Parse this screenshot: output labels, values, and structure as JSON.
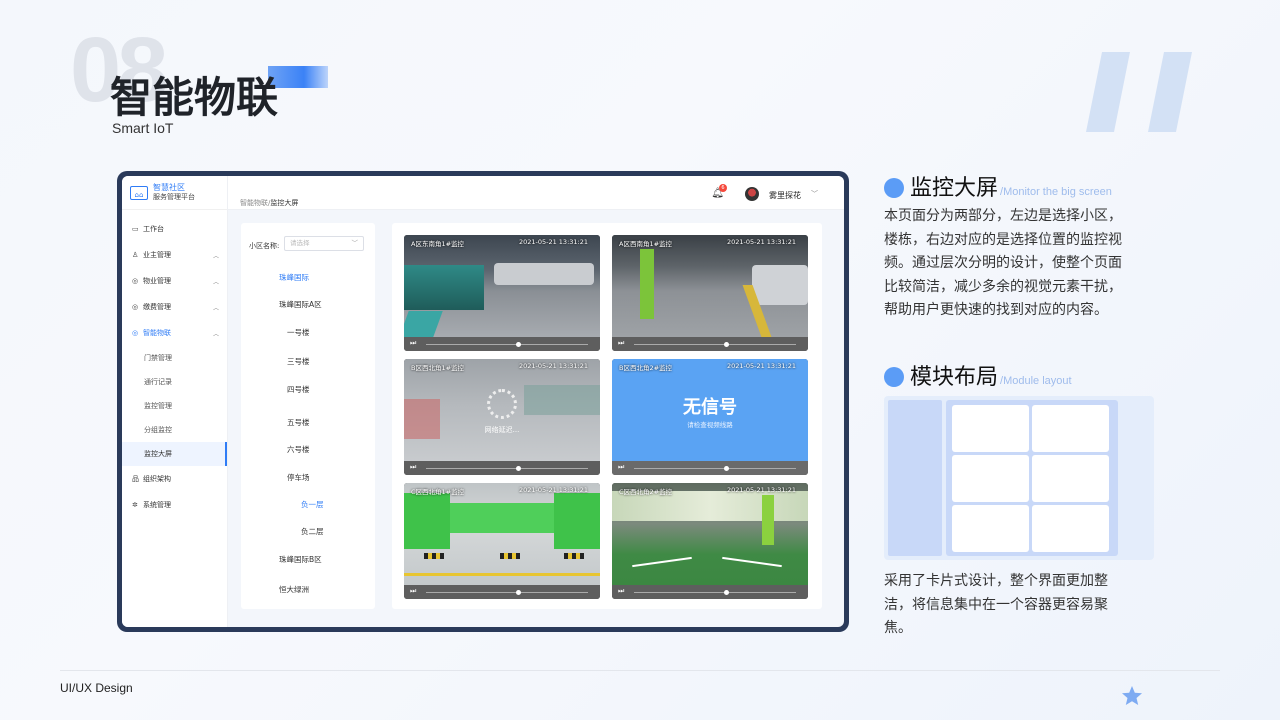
{
  "header": {
    "section_number": "08",
    "title": "智能物联",
    "subtitle": "Smart IoT"
  },
  "footer": {
    "label": "UI/UX Design"
  },
  "app": {
    "brand_line1": "智慧社区",
    "brand_line2": "服务管理平台",
    "breadcrumb_parent": "智能物联/",
    "breadcrumb_current": "监控大屏",
    "notification_count": "6",
    "username": "雾里探花",
    "sidebar": [
      {
        "label": "工作台",
        "icon": "▭"
      },
      {
        "label": "业主管理",
        "icon": "♙"
      },
      {
        "label": "物业管理",
        "icon": "◎"
      },
      {
        "label": "缴费管理",
        "icon": "◎"
      },
      {
        "label": "智能物联",
        "icon": "◎"
      },
      {
        "label": "门禁管理"
      },
      {
        "label": "通行记录"
      },
      {
        "label": "监控管理"
      },
      {
        "label": "分组监控"
      },
      {
        "label": "监控大屏"
      },
      {
        "label": "组织架构",
        "icon": "品"
      },
      {
        "label": "系统管理",
        "icon": "✲"
      }
    ],
    "filter": {
      "label": "小区名称:",
      "placeholder": "请选择"
    },
    "tree": [
      "珠峰国际",
      "珠峰国际A区",
      "一号楼",
      "三号楼",
      "四号楼",
      "五号楼",
      "六号楼",
      "停车场",
      "负一层",
      "负二层",
      "珠峰国际B区",
      "恒大绿洲"
    ],
    "cameras": [
      {
        "name": "A区东南角1#监控",
        "time": "2021-05-21    13:31:21"
      },
      {
        "name": "A区西南角1#监控",
        "time": "2021-05-21    13:31:21"
      },
      {
        "name": "B区西北角1#监控",
        "time": "2021-05-21    13:31:21",
        "overlay": "网络延迟..."
      },
      {
        "name": "B区西北角2#监控",
        "time": "2021-05-21    13:31:21",
        "no_signal": "无信号",
        "no_signal_hint": "请检查视频线路"
      },
      {
        "name": "C区西北角1#监控",
        "time": "2021-05-21    13:31:21"
      },
      {
        "name": "C区西北角2#监控",
        "time": "2021-05-21    13:31:21"
      }
    ]
  },
  "panel": {
    "section1_title": "监控大屏",
    "section1_en": "/Monitor the big screen",
    "section1_text": "本页面分为两部分，左边是选择小区，楼栋，右边对应的是选择位置的监控视频。通过层次分明的设计，使整个页面比较简洁，减少多余的视觉元素干扰，帮助用户更快速的找到对应的内容。",
    "section2_title": "模块布局",
    "section2_en": "/Module layout",
    "section2_text": "采用了卡片式设计，整个界面更加整洁，将信息集中在一个容器更容易聚焦。"
  },
  "colors": {
    "accent": "#2f7cf6",
    "dot": "#5b9cf6",
    "frame": "#2a3a5a",
    "no_signal_bg": "#5aa3f3"
  }
}
